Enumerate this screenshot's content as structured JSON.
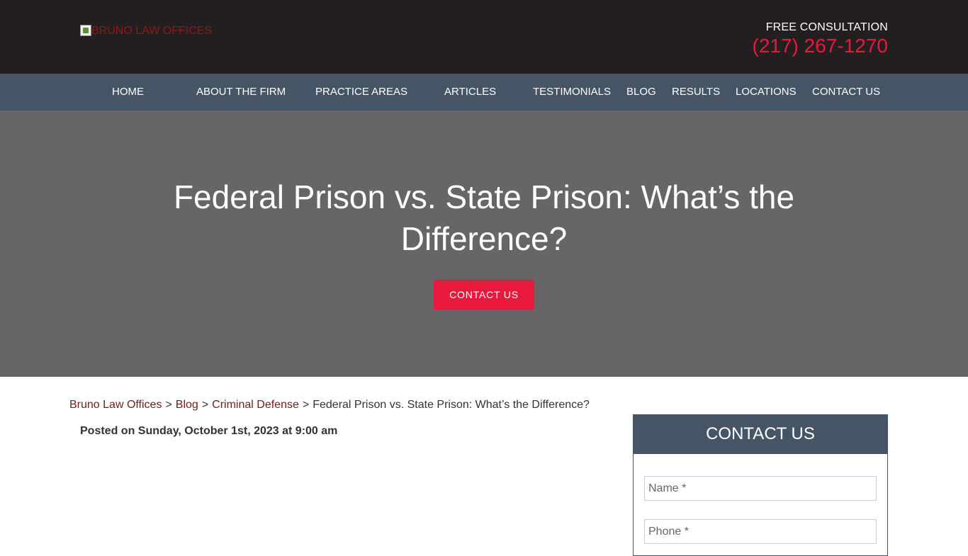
{
  "header": {
    "logo_alt": "BRUNO LAW OFFICES",
    "consult_label": "FREE CONSULTATION",
    "phone": "(217) 267-1270"
  },
  "nav": {
    "items": [
      {
        "label": "HOME"
      },
      {
        "label": "ABOUT THE FIRM"
      },
      {
        "label": "PRACTICE AREAS"
      },
      {
        "label": "ARTICLES"
      },
      {
        "label": "TESTIMONIALS"
      },
      {
        "label": "BLOG"
      },
      {
        "label": "RESULTS"
      },
      {
        "label": "LOCATIONS"
      },
      {
        "label": "CONTACT US"
      }
    ]
  },
  "hero": {
    "title": "Federal Prison vs. State Prison: What’s the Difference?",
    "cta_label": "CONTACT US"
  },
  "breadcrumb": {
    "items": [
      "Bruno Law Offices",
      "Blog",
      "Criminal Defense"
    ],
    "separator": ">",
    "current": "Federal Prison vs. State Prison: What’s the Difference?"
  },
  "post": {
    "posted_prefix": "Posted on",
    "date": "Sunday, October 1st, 2023 at 9:00 am"
  },
  "sidebar": {
    "contact_title": "CONTACT US",
    "name_placeholder": "Name *",
    "phone_placeholder": "Phone *"
  },
  "colors": {
    "topbar": "#231f20",
    "nav": "#455566",
    "hero": "#666666",
    "accent": "#e8193c",
    "link": "#6b1f1f"
  }
}
